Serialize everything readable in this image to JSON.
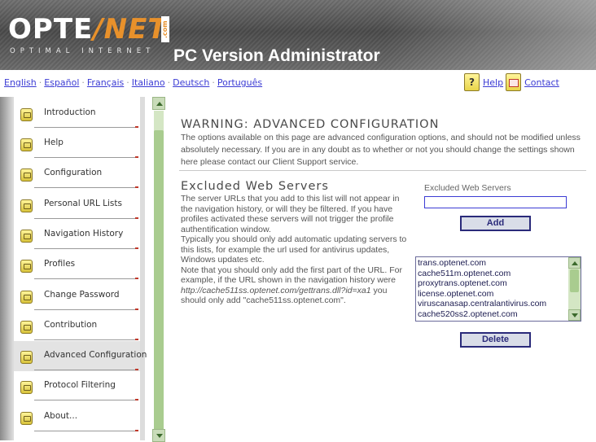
{
  "header": {
    "logo_main_left": "OPTE",
    "logo_main_right": "NET",
    "logo_com": ".com",
    "logo_sub": "OPTIMAL INTERNET",
    "app_title": "PC Version Administrator"
  },
  "langbar": {
    "languages": [
      "English",
      "Español",
      "Français",
      "Italiano",
      "Deutsch",
      "Português"
    ],
    "separator": "·",
    "help_icon": "?",
    "help_label": "Help",
    "contact_label": "Contact"
  },
  "sidebar": {
    "items": [
      {
        "label": "Introduction",
        "icon": "folder-icon"
      },
      {
        "label": "Help",
        "icon": "folder-icon"
      },
      {
        "label": "Configuration",
        "icon": "folder-icon"
      },
      {
        "label": "Personal URL Lists",
        "icon": "folder-icon"
      },
      {
        "label": "Navigation History",
        "icon": "folder-icon"
      },
      {
        "label": "Profiles",
        "icon": "folder-icon"
      },
      {
        "label": "Change Password",
        "icon": "folder-icon"
      },
      {
        "label": "Contribution",
        "icon": "folder-icon"
      },
      {
        "label": "Advanced Configuration",
        "icon": "folder-icon",
        "active": true
      },
      {
        "label": "Protocol Filtering",
        "icon": "folder-icon"
      },
      {
        "label": "About...",
        "icon": "folder-icon"
      }
    ]
  },
  "main": {
    "warning_title": "WARNING: ADVANCED CONFIGURATION",
    "warning_text": "The options available on this page are advanced configuration options, and should not be modified unless absolutely necessary. If you are in any doubt as to whether or not you should change the settings shown here please contact our Client Support service.",
    "section_title": "Excluded Web Servers",
    "section_p1": "The server URLs that you add to this list will not appear in the navigation history, or will they be filtered. If you have profiles activated these servers will not trigger the profile authentification window.",
    "section_p2": "Typically you should only add automatic updating servers to this lists, for example the url used for antivirus updates, Windows updates etc.",
    "section_p3_start": "Note that you should only add the first part of the URL. For example, if the URL shown in the navigation history were ",
    "section_p3_example": "http://cache511ss.optenet.com/gettrans.dll?id=xa1",
    "section_p3_end": " you should only add \"cache511ss.optenet.com\".",
    "field_label": "Excluded Web Servers",
    "field_value": "",
    "add_label": "Add",
    "delete_label": "Delete",
    "servers": [
      "trans.optenet.com",
      "cache511m.optenet.com",
      "proxytrans.optenet.com",
      "license.optenet.com",
      "viruscanasap.centralantivirus.com",
      "cache520ss2.optenet.com"
    ]
  },
  "colors": {
    "link": "#3b3bd4",
    "accent_orange": "#e8912b",
    "button_border": "#2a2a7a",
    "scrollbar": "#a9cc8f"
  }
}
